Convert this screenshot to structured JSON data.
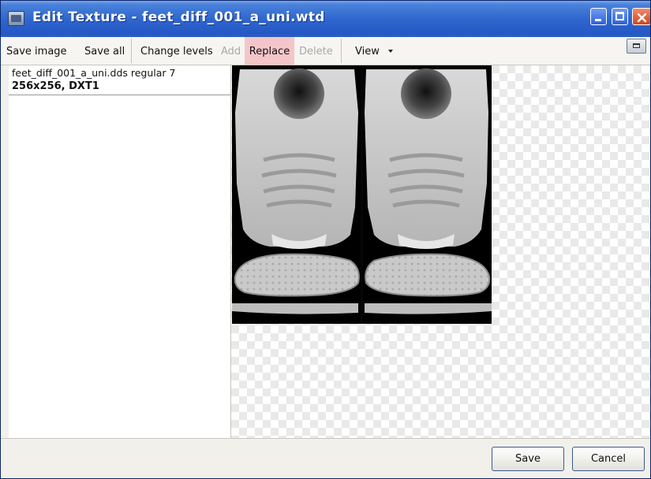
{
  "window": {
    "title": "Edit Texture - feet_diff_001_a_uni.wtd",
    "icon": "texture-app-icon",
    "controls": [
      "minimize-icon",
      "maximize-icon",
      "close-icon"
    ]
  },
  "toolbar": {
    "save_image": "Save image",
    "save_all": "Save all",
    "change_levels": "Change levels",
    "add": "Add",
    "replace": "Replace",
    "delete": "Delete",
    "view": "View"
  },
  "texture_list": {
    "name": "feet_diff_001_a_uni.dds regular 7",
    "info": "256x256, DXT1"
  },
  "preview": {
    "content": "sneaker texture atlas (top views and soles)"
  },
  "footer": {
    "save": "Save",
    "cancel": "Cancel"
  },
  "colors": {
    "titlebar": "#2f66cf",
    "replace_highlight": "#f4c6c9",
    "close_button": "#d2451e"
  }
}
